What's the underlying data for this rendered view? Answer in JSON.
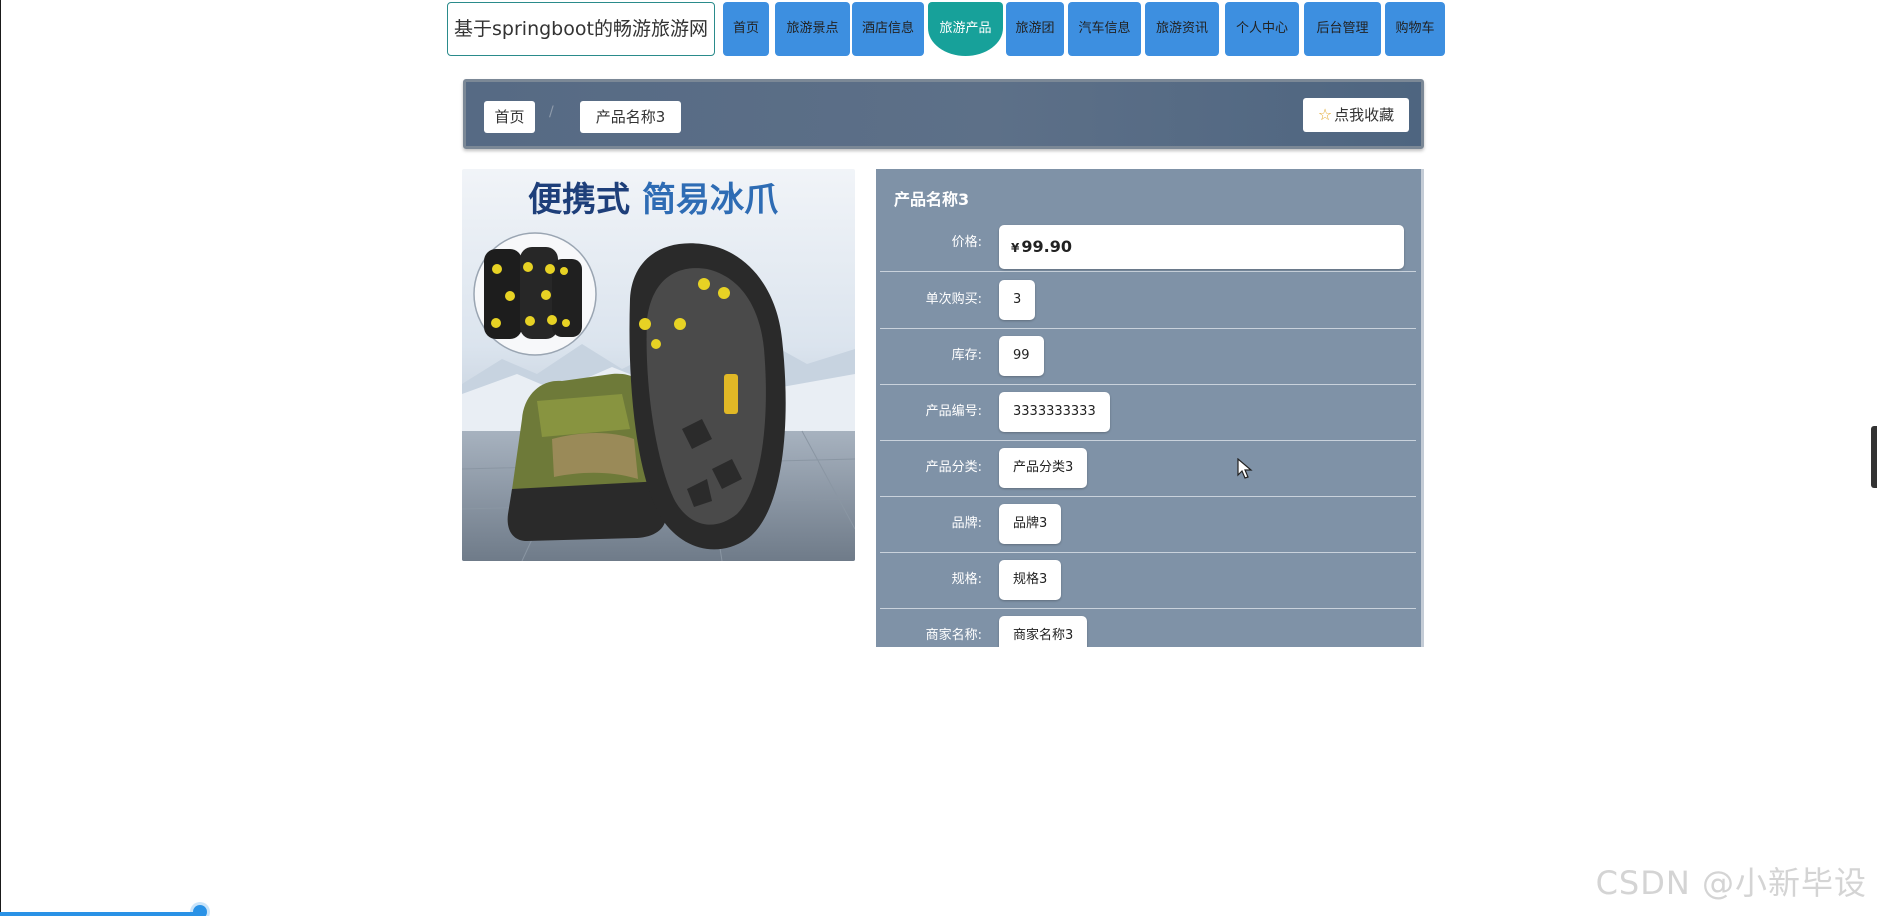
{
  "header": {
    "site_title": "基于springboot的畅游旅游网",
    "nav": [
      {
        "label": "首页"
      },
      {
        "label": "旅游景点"
      },
      {
        "label": "酒店信息"
      },
      {
        "label": "旅游产品",
        "active": true
      },
      {
        "label": "旅游团"
      },
      {
        "label": "汽车信息"
      },
      {
        "label": "旅游资讯"
      },
      {
        "label": "个人中心"
      },
      {
        "label": "后台管理"
      },
      {
        "label": "购物车"
      }
    ]
  },
  "breadcrumb": {
    "home": "首页",
    "current": "产品名称3",
    "favorite_label": "点我收藏"
  },
  "product": {
    "image_caption": "便携式简易冰爪",
    "image_caption_highlight": "便携式",
    "image_caption_rest": "简易冰爪",
    "name": "产品名称3",
    "currency_symbol": "¥",
    "fields": [
      {
        "label": "价格:",
        "value": "99.90"
      },
      {
        "label": "单次购买:",
        "value": "3"
      },
      {
        "label": "库存:",
        "value": "99"
      },
      {
        "label": "产品编号:",
        "value": "3333333333"
      },
      {
        "label": "产品分类:",
        "value": "产品分类3"
      },
      {
        "label": "品牌:",
        "value": "品牌3"
      },
      {
        "label": "规格:",
        "value": "规格3"
      },
      {
        "label": "商家名称:",
        "value": "商家名称3"
      }
    ]
  },
  "watermark": "CSDN @小新毕设",
  "colors": {
    "nav_blue": "#3d8fe0",
    "nav_active": "#17a19a",
    "crumb_bar": "#566a84",
    "panel": "#7f92a7"
  }
}
